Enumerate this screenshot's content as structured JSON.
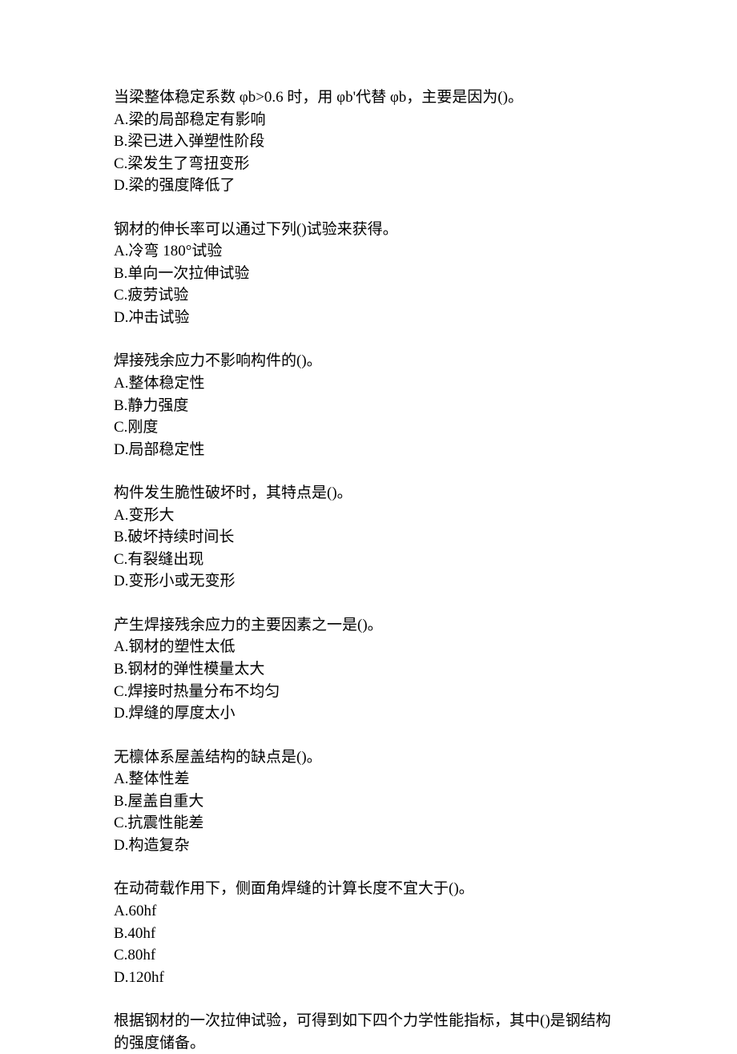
{
  "questions": [
    {
      "text": "当梁整体稳定系数 φb>0.6 时，用 φb'代替 φb，主要是因为()。",
      "options": [
        "A.梁的局部稳定有影响",
        "B.梁已进入弹塑性阶段",
        "C.梁发生了弯扭变形",
        "D.梁的强度降低了"
      ]
    },
    {
      "text": "钢材的伸长率可以通过下列()试验来获得。",
      "options": [
        "A.冷弯 180°试验",
        "B.单向一次拉伸试验",
        "C.疲劳试验",
        "D.冲击试验"
      ]
    },
    {
      "text": "焊接残余应力不影响构件的()。",
      "options": [
        "A.整体稳定性",
        "B.静力强度",
        "C.刚度",
        "D.局部稳定性"
      ]
    },
    {
      "text": "构件发生脆性破坏时，其特点是()。",
      "options": [
        "A.变形大",
        "B.破坏持续时间长",
        "C.有裂缝出现",
        "D.变形小或无变形"
      ]
    },
    {
      "text": "产生焊接残余应力的主要因素之一是()。",
      "options": [
        "A.钢材的塑性太低",
        "B.钢材的弹性模量太大",
        "C.焊接时热量分布不均匀",
        "D.焊缝的厚度太小"
      ]
    },
    {
      "text": "无檩体系屋盖结构的缺点是()。",
      "options": [
        "A.整体性差",
        "B.屋盖自重大",
        "C.抗震性能差",
        "D.构造复杂"
      ]
    },
    {
      "text": "在动荷载作用下，侧面角焊缝的计算长度不宜大于()。",
      "options": [
        "A.60hf",
        "B.40hf",
        "C.80hf",
        "D.120hf"
      ]
    },
    {
      "text": "根据钢材的一次拉伸试验，可得到如下四个力学性能指标，其中()是钢结构的强度储备。",
      "options": []
    }
  ]
}
